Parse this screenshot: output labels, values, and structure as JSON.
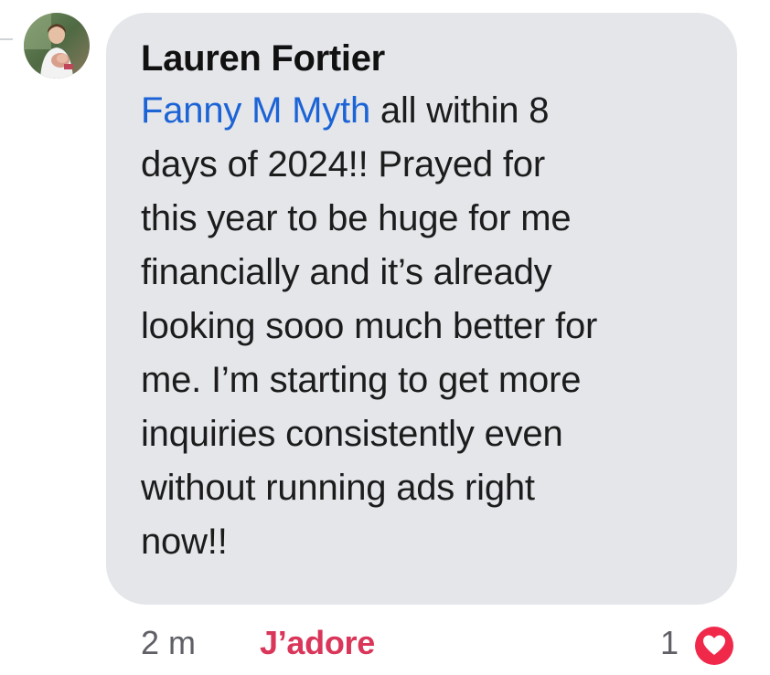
{
  "comment": {
    "author": "Lauren Fortier",
    "mention": "Fanny M Myth",
    "body_lines": [
      " all within 8",
      "days of 2024!! Prayed for",
      "this year to be huge for me",
      "financially and it’s already",
      "looking sooo much better for",
      "me. I’m starting to get more",
      "inquiries consistently even",
      "without running ads right",
      "now!!"
    ],
    "timestamp": "2 m",
    "react_label": "J’adore",
    "reaction_count": "1",
    "reaction_icon": "heart-icon"
  },
  "colors": {
    "bubble_bg": "#e4e6ea",
    "mention": "#1c64d6",
    "react_label": "#d9365a",
    "heart": "#f0284a",
    "meta_text": "#5f6166"
  }
}
